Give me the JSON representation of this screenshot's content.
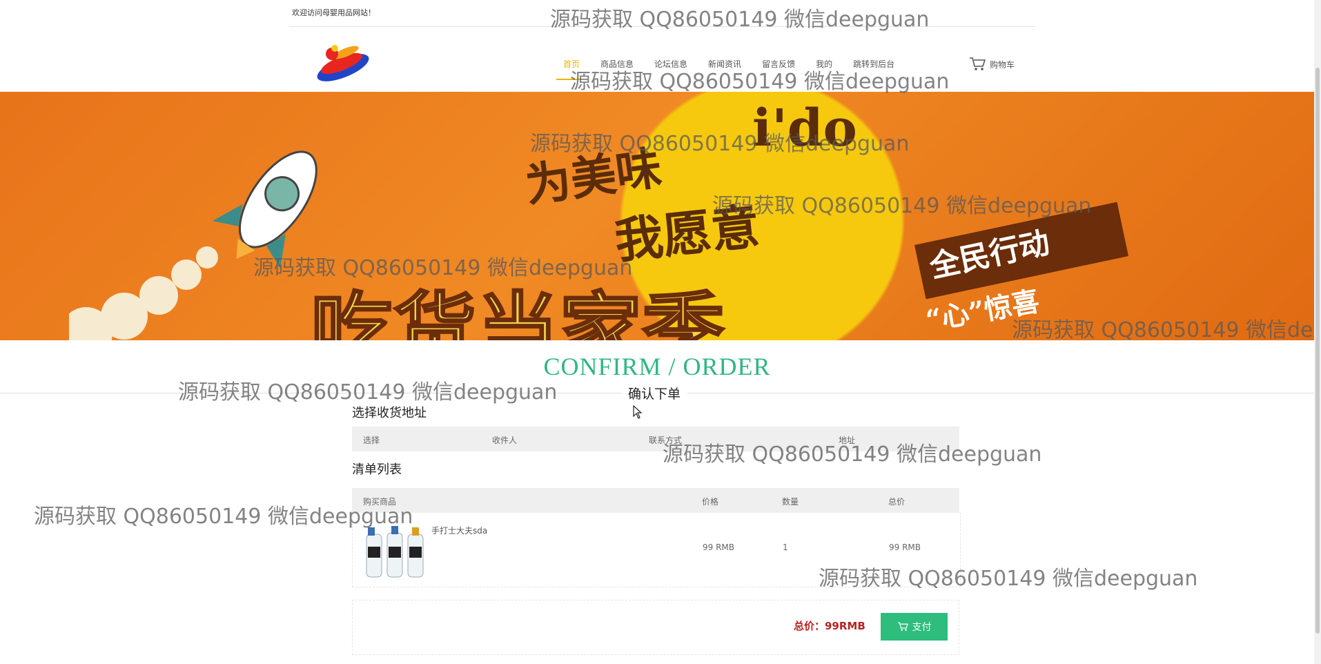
{
  "header": {
    "welcome": "欢迎访问母婴用品网站！",
    "nav": [
      "首页",
      "商品信息",
      "论坛信息",
      "新闻资讯",
      "留言反馈",
      "我的",
      "跳转到后台"
    ],
    "cart_label": "购物车"
  },
  "banner": {
    "text_ido": "i'do",
    "text_1": "为美味",
    "text_2": "我愿意",
    "text_3": "吃货当家季",
    "text_4": "全民行动",
    "text_5": "“心”惊喜"
  },
  "confirm": {
    "title": "CONFIRM / ORDER",
    "subtitle": "确认下单"
  },
  "address": {
    "title": "选择收货地址",
    "headers": [
      "选择",
      "收件人",
      "联系方式",
      "地址"
    ]
  },
  "list": {
    "title": "清单列表",
    "headers": [
      "购买商品",
      "价格",
      "数量",
      "总价"
    ],
    "items": [
      {
        "name": "手打士大夫sda",
        "price": "99 RMB",
        "qty": "1",
        "total": "99 RMB"
      }
    ]
  },
  "order": {
    "total": "总价：99RMB",
    "pay_label": "支付"
  },
  "watermark": "源码获取 QQ86050149 微信deepguan",
  "colors": {
    "accent": "#2fb682",
    "nav_active": "#e6b800",
    "total": "#b52323",
    "pay": "#2ebd7c"
  }
}
